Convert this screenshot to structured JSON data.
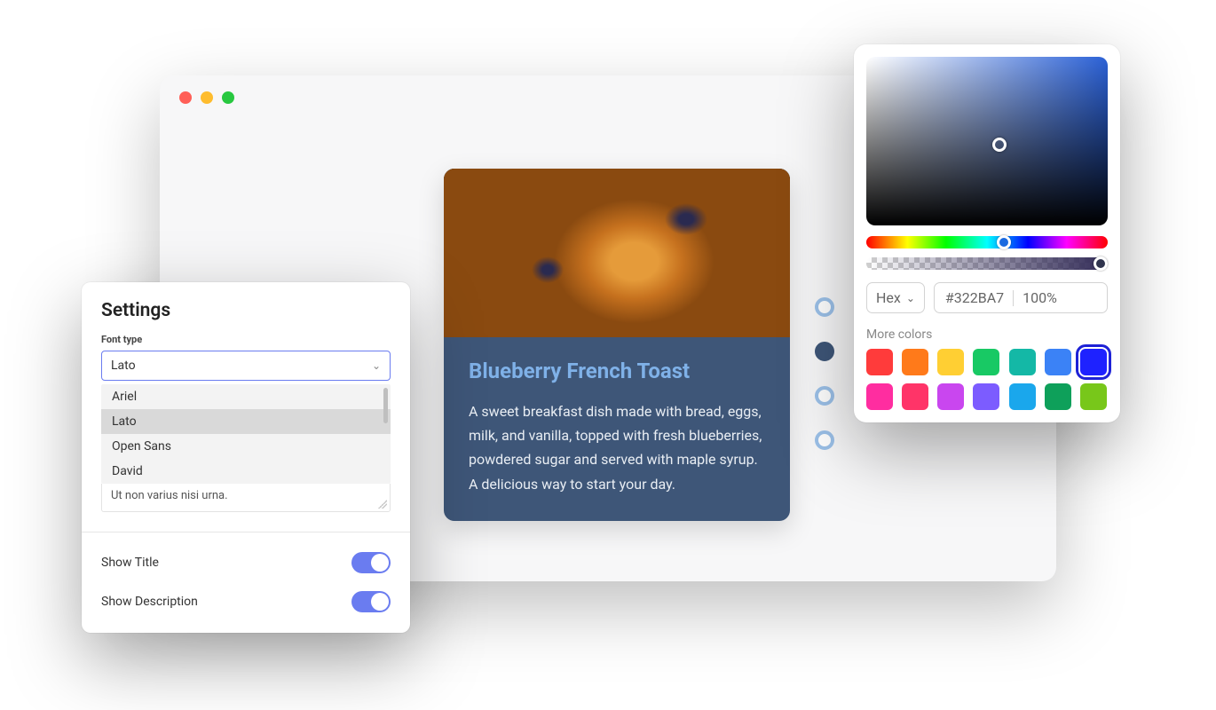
{
  "card": {
    "title": "Blueberry French Toast",
    "description": "A sweet breakfast dish made with bread, eggs, milk, and vanilla, topped with fresh blueberries, powdered sugar and served with maple syrup. A delicious way to start your day."
  },
  "dots": {
    "active_index": 1,
    "count": 4
  },
  "settings": {
    "title": "Settings",
    "font_type_label": "Font type",
    "font_selected": "Lato",
    "font_options": [
      "Ariel",
      "Lato",
      "Open Sans",
      "David"
    ],
    "sample_text": "Ut non varius nisi urna.",
    "show_title_label": "Show Title",
    "show_title_value": true,
    "show_description_label": "Show Description",
    "show_description_value": true
  },
  "color_picker": {
    "format_label": "Hex",
    "hex_value": "#322BA7",
    "alpha_value": "100%",
    "more_colors_label": "More colors",
    "swatches_row1": [
      "#ff3b3b",
      "#ff7a1a",
      "#ffcf33",
      "#18c964",
      "#14b8a6",
      "#3b82f6",
      "#1e22ff"
    ],
    "swatches_row2": [
      "#ff2da0",
      "#ff3468",
      "#c946ef",
      "#7c5cff",
      "#1aa7ec",
      "#0ea05a",
      "#78c71a"
    ],
    "selected_swatch_index": 6
  }
}
